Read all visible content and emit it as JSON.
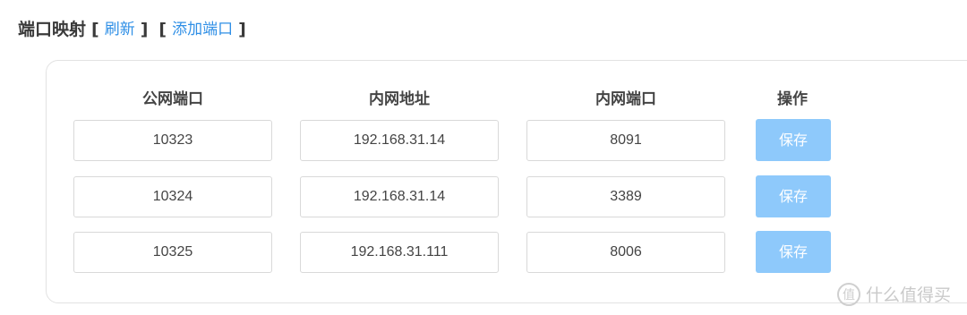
{
  "header": {
    "title": "端口映射",
    "open_bracket_1": "[",
    "close_bracket_1": "]",
    "refresh_label": "刷新",
    "open_bracket_2": "[",
    "close_bracket_2": "]",
    "add_port_label": "添加端口"
  },
  "table": {
    "columns": [
      "公网端口",
      "内网地址",
      "内网端口",
      "操作"
    ],
    "rows": [
      {
        "public_port": "10323",
        "internal_address": "192.168.31.14",
        "internal_port": "8091",
        "action": "保存"
      },
      {
        "public_port": "10324",
        "internal_address": "192.168.31.14",
        "internal_port": "3389",
        "action": "保存"
      },
      {
        "public_port": "10325",
        "internal_address": "192.168.31.111",
        "internal_port": "8006",
        "action": "保存"
      }
    ]
  },
  "colors": {
    "link": "#2f8fe6",
    "button": "#8ec9fb"
  },
  "watermark": {
    "logo_char": "值",
    "text": "什么值得买"
  }
}
